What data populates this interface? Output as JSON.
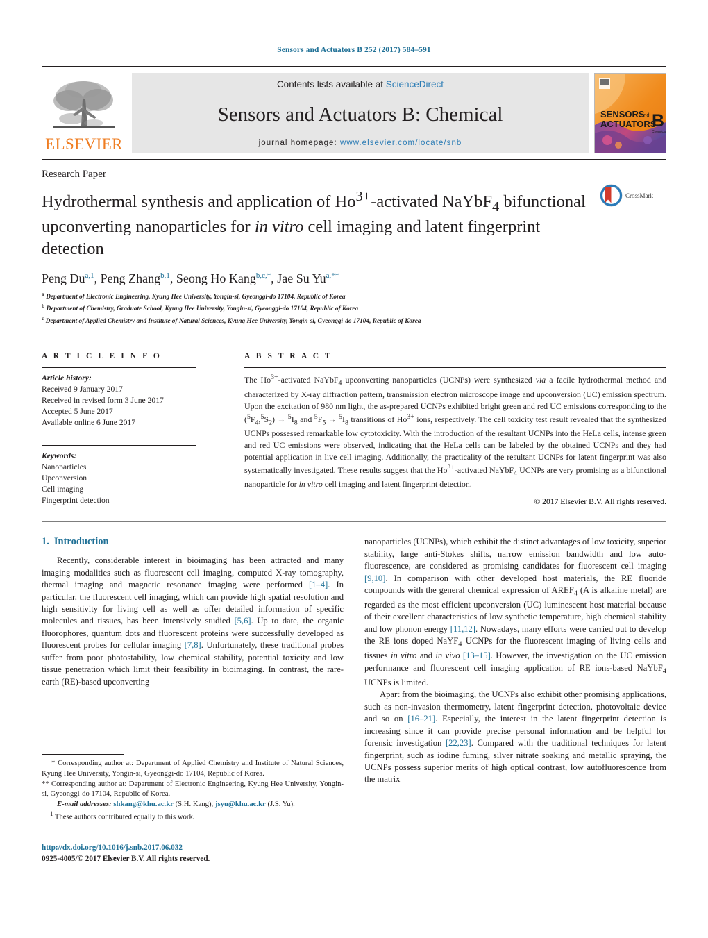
{
  "running_head": "Sensors and Actuators B 252 (2017) 584–591",
  "masthead": {
    "contents_prefix": "Contents lists available at ",
    "contents_link": "ScienceDirect",
    "journal_title": "Sensors and Actuators B: Chemical",
    "homepage_prefix": "journal homepage: ",
    "homepage_url": "www.elsevier.com/locate/snb",
    "publisher_wordmark": "ELSEVIER",
    "cover_line1": "SENSORS",
    "cover_and": "and",
    "cover_line2": "ACTUATORS",
    "cover_letter": "B",
    "cover_sub": "Chemical"
  },
  "article": {
    "type": "Research Paper",
    "title_part1": "Hydrothermal synthesis and application of Ho",
    "title_sup1": "3+",
    "title_part2": "-activated NaYbF",
    "title_sub1": "4",
    "title_part3": " bifunctional upconverting nanoparticles for ",
    "title_italic": "in vitro",
    "title_part4": " cell imaging and latent fingerprint detection",
    "crossmark_label": "CrossMark"
  },
  "authors": {
    "list": [
      {
        "name": "Peng Du",
        "sup": "a,1"
      },
      {
        "name": "Peng Zhang",
        "sup": "b,1"
      },
      {
        "name": "Seong Ho Kang",
        "sup": "b,c,*"
      },
      {
        "name": "Jae Su Yu",
        "sup": "a,**"
      }
    ],
    "affiliations": [
      {
        "mark": "a",
        "text": "Department of Electronic Engineering, Kyung Hee University, Yongin-si, Gyeonggi-do 17104, Republic of Korea"
      },
      {
        "mark": "b",
        "text": "Department of Chemistry, Graduate School, Kyung Hee University, Yongin-si, Gyeonggi-do 17104, Republic of Korea"
      },
      {
        "mark": "c",
        "text": "Department of Applied Chemistry and Institute of Natural Sciences, Kyung Hee University, Yongin-si, Gyeonggi-do 17104, Republic of Korea"
      }
    ]
  },
  "article_info": {
    "heading": "A R T I C L E   I N F O",
    "history_label": "Article history:",
    "history": [
      "Received 9 January 2017",
      "Received in revised form 3 June 2017",
      "Accepted 5 June 2017",
      "Available online 6 June 2017"
    ],
    "keywords_label": "Keywords:",
    "keywords": [
      "Nanoparticles",
      "Upconversion",
      "Cell imaging",
      "Fingerprint detection"
    ]
  },
  "abstract": {
    "heading": "A B S T R A C T",
    "p1_a": "The Ho",
    "p1_sup": "3+",
    "p1_b": "-activated NaYbF",
    "p1_sub": "4",
    "p1_c": " upconverting nanoparticles (UCNPs) were synthesized ",
    "p1_via": "via",
    "p1_d": " a facile hydrothermal method and characterized by X-ray diffraction pattern, transmission electron microscope image and upconversion (UC) emission spectrum. Upon the excitation of 980 nm light, the as-prepared UCNPs exhibited bright green and red UC emissions corresponding to the (",
    "trans1": "(5F4,5S2) → 5I8",
    "trans2": "5F5 → 5I8",
    "p1_e": " transitions of Ho",
    "p1_f": " ions, respectively. The cell toxicity test result revealed that the synthesized UCNPs possessed remarkable low cytotoxicity. With the introduction of the resultant UCNPs into the HeLa cells, intense green and red UC emissions were observed, indicating that the HeLa cells can be labeled by the obtained UCNPs and they had potential application in live cell imaging. Additionally, the practicality of the resultant UCNPs for latent fingerprint was also systematically investigated. These results suggest that the Ho",
    "p1_g": "-activated NaYbF",
    "p1_h": " UCNPs are very promising as a bifunctional nanoparticle for ",
    "p1_invitro": "in vitro",
    "p1_i": " cell imaging and latent fingerprint detection.",
    "copyright": "© 2017 Elsevier B.V. All rights reserved."
  },
  "introduction": {
    "number": "1.",
    "heading": "Introduction",
    "left_p1_a": "Recently, considerable interest in bioimaging has been attracted and many imaging modalities such as fluorescent cell imaging, computed X-ray tomography, thermal imaging and magnetic resonance imaging were performed ",
    "left_ref1": "[1–4]",
    "left_p1_b": ". In particular, the fluorescent cell imaging, which can provide high spatial resolution and high sensitivity for living cell as well as offer detailed information of specific molecules and tissues, has been intensively studied ",
    "left_ref2": "[5,6]",
    "left_p1_c": ". Up to date, the organic fluorophores, quantum dots and fluorescent proteins were successfully developed as fluorescent probes for cellular imaging ",
    "left_ref3": "[7,8]",
    "left_p1_d": ". Unfortunately, these traditional probes suffer from poor photostability, low chemical stability, potential toxicity and low tissue penetration which limit their feasibility in bioimaging. In contrast, the rare-earth (RE)-based upconverting",
    "right_p1_a": "nanoparticles (UCNPs), which exhibit the distinct advantages of low toxicity, superior stability, large anti-Stokes shifts, narrow emission bandwidth and low auto-fluorescence, are considered as promising candidates for fluorescent cell imaging ",
    "right_ref1": "[9,10]",
    "right_p1_b": ". In comparison with other developed host materials, the RE fluoride compounds with the general chemical expression of AREF",
    "right_sub1": "4",
    "right_p1_c": " (A is alkaline metal) are regarded as the most efficient upconversion (UC) luminescent host material because of their excellent characteristics of low synthetic temperature, high chemical stability and low phonon energy ",
    "right_ref2": "[11,12]",
    "right_p1_d": ". Nowadays, many efforts were carried out to develop the RE ions doped NaYF",
    "right_sub2": "4",
    "right_p1_e": " UCNPs for the fluorescent imaging of living cells and tissues ",
    "right_invitro": "in vitro",
    "right_and": " and ",
    "right_invivo": "in vivo",
    "right_space": " ",
    "right_ref3": "[13–15]",
    "right_p1_f": ". However, the investigation on the UC emission performance and fluorescent cell imaging application of RE ions-based NaYbF",
    "right_sub3": "4",
    "right_p1_g": " UCNPs is limited.",
    "right_p2_a": "Apart from the bioimaging, the UCNPs also exhibit other promising applications, such as non-invasion thermometry, latent fingerprint detection, photovoltaic device and so on ",
    "right_ref4": "[16–21]",
    "right_p2_b": ". Especially, the interest in the latent fingerprint detection is increasing since it can provide precise personal information and be helpful for forensic investigation ",
    "right_ref5": "[22,23]",
    "right_p2_c": ". Compared with the traditional techniques for latent fingerprint, such as iodine fuming, silver nitrate soaking and metallic spraying, the UCNPs possess superior merits of high optical contrast, low autofluorescence from the matrix"
  },
  "footnotes": {
    "star_mark": "*",
    "star_text": " Corresponding author at: Department of Applied Chemistry and Institute of Natural Sciences, Kyung Hee University, Yongin-si, Gyeonggi-do 17104, Republic of Korea.",
    "dstar_mark": "**",
    "dstar_text": " Corresponding author at: Department of Electronic Engineering, Kyung Hee University, Yongin-si, Gyeonggi-do 17104, Republic of Korea.",
    "email_label": "E-mail addresses:",
    "email1": "shkang@khu.ac.kr",
    "email1_owner": " (S.H. Kang), ",
    "email2": "jsyu@khu.ac.kr",
    "email2_owner": " (J.S. Yu).",
    "one_mark": "1",
    "one_text": " These authors contributed equally to this work."
  },
  "footer": {
    "doi": "http://dx.doi.org/10.1016/j.snb.2017.06.032",
    "issn": "0925-4005/© 2017 Elsevier B.V. All rights reserved."
  },
  "colors": {
    "link": "#1f7096",
    "elsevier_orange": "#ef7d22",
    "masthead_bg": "#e6e6e6"
  }
}
